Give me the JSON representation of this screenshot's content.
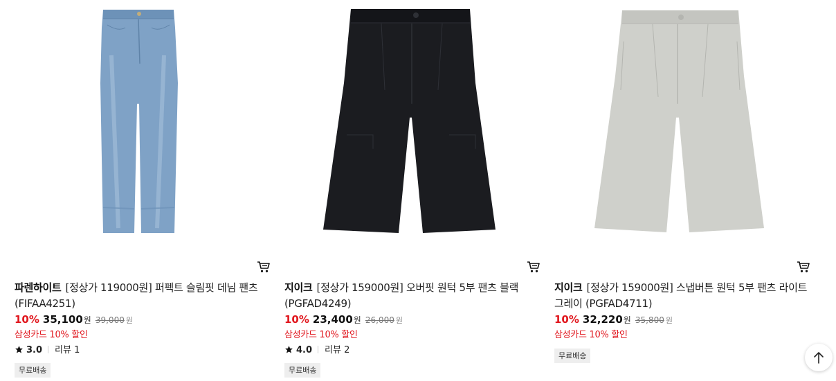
{
  "products": [
    {
      "brand": "파렌하이트",
      "name": "[정상가 119000원] 퍼펙트 슬림핏 데님 팬츠 (FIFAA4251)",
      "discount": "10%",
      "price": "35,100",
      "price_unit": "원",
      "original_price": "39,000",
      "original_unit": "원",
      "card_promo": "삼성카드 10% 할인",
      "rating": "3.0",
      "review_label": "리뷰 1",
      "badge": "무료배송",
      "image_icon": "denim-jeans-image",
      "colors": {
        "main": "#7fa2c6",
        "dark": "#5f83a8",
        "light": "#a6c0db"
      }
    },
    {
      "brand": "지이크",
      "name": "[정상가 159000원] 오버핏 원턱 5부 팬츠 블랙 (PGFAD4249)",
      "discount": "10%",
      "price": "23,400",
      "price_unit": "원",
      "original_price": "26,000",
      "original_unit": "원",
      "card_promo": "삼성카드 10% 할인",
      "rating": "4.0",
      "review_label": "리뷰 2",
      "badge": "무료배송",
      "image_icon": "black-shorts-image",
      "colors": {
        "main": "#1b1c20",
        "dark": "#0c0d10",
        "light": "#2e3036"
      }
    },
    {
      "brand": "지이크",
      "name": "[정상가 159000원] 스냅버튼 원턱 5부 팬츠 라이트그레이 (PGFAD4711)",
      "discount": "10%",
      "price": "32,220",
      "price_unit": "원",
      "original_price": "35,800",
      "original_unit": "원",
      "card_promo": "삼성카드 10% 할인",
      "rating": "",
      "review_label": "",
      "badge": "무료배송",
      "image_icon": "gray-shorts-image",
      "colors": {
        "main": "#cfd0cb",
        "dark": "#b4b5b0",
        "light": "#dfe0db"
      }
    }
  ],
  "scroll_top_icon": "arrow-up-icon",
  "accent_color": "#e1171e"
}
